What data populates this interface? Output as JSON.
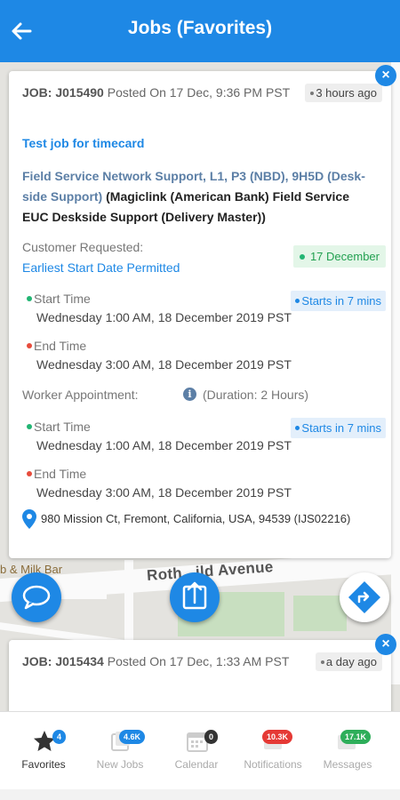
{
  "header": {
    "title": "Jobs (Favorites)"
  },
  "map": {
    "street": "Roth...ild Avenue",
    "poi": "b & Milk Bar"
  },
  "jobs": [
    {
      "id_label": "JOB: J015490",
      "posted": " Posted On 17 Dec, 9:36 PM PST",
      "ago": "3 hours ago",
      "title": "Test job for timecard",
      "desc_blue": "Field Service Network Support, L1, P3 (NBD), 9H5D (Desk-side Support)",
      "desc_black": " (Magiclink (American Bank) Field Service EUC Deskside Support (Delivery Master))",
      "customer_requested_label": "Customer Requested:",
      "earliest_start": "Earliest Start Date Permitted",
      "date_badge": "17 December",
      "customer": {
        "start_label": "Start Time",
        "start_value": "Wednesday 1:00 AM, 18 December 2019 PST",
        "starts_in": "Starts in 7 mins",
        "end_label": "End Time",
        "end_value": "Wednesday 3:00 AM, 18 December 2019 PST"
      },
      "worker_label": "Worker Appointment:",
      "duration": "(Duration: 2 Hours)",
      "worker": {
        "start_label": "Start Time",
        "start_value": "Wednesday 1:00 AM, 18 December 2019 PST",
        "starts_in": "Starts in 7 mins",
        "end_label": "End Time",
        "end_value": "Wednesday 3:00 AM, 18 December 2019 PST"
      },
      "address": "980 Mission Ct, Fremont, California, USA, 94539 (IJS02216)"
    },
    {
      "id_label": "JOB: J015434",
      "posted": " Posted On 17 Dec, 1:33 AM PST",
      "ago": "a day ago"
    }
  ],
  "nav": [
    {
      "label": "Favorites",
      "count": "4",
      "icon": "star-icon",
      "color": "#1e88e5"
    },
    {
      "label": "New Jobs",
      "count": "4.6K",
      "icon": "new-jobs-icon",
      "color": "#1e88e5"
    },
    {
      "label": "Calendar",
      "count": "0",
      "icon": "calendar-icon",
      "color": "#333333"
    },
    {
      "label": "Notifications",
      "count": "10.3K",
      "icon": "notifications-icon",
      "color": "#e53935"
    },
    {
      "label": "Messages",
      "count": "17.1K",
      "icon": "messages-icon",
      "color": "#2eae5a"
    }
  ],
  "colors": {
    "primary": "#1e88e5",
    "green": "#22a050",
    "red": "#e74c3c"
  }
}
